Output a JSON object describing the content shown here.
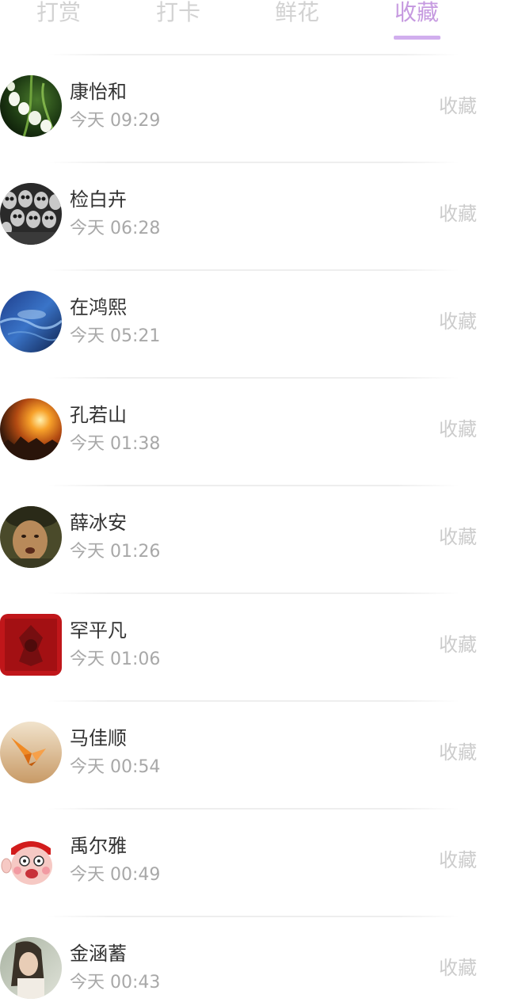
{
  "tabs": [
    {
      "label": "打赏",
      "active": false
    },
    {
      "label": "打卡",
      "active": false
    },
    {
      "label": "鲜花",
      "active": false
    },
    {
      "label": "收藏",
      "active": true
    }
  ],
  "accent_color": "#c69ae0",
  "items": [
    {
      "name": "康怡和",
      "time": "今天 09:29",
      "action": "收藏",
      "avatar": "lily-of-the-valley-flowers"
    },
    {
      "name": "检白卉",
      "time": "今天 06:28",
      "action": "收藏",
      "avatar": "skull-crowd"
    },
    {
      "name": "在鸿熙",
      "time": "今天 05:21",
      "action": "收藏",
      "avatar": "blue-ocean"
    },
    {
      "name": "孔若山",
      "time": "今天 01:38",
      "action": "收藏",
      "avatar": "fiery-explosion"
    },
    {
      "name": "薛冰安",
      "time": "今天 01:26",
      "action": "收藏",
      "avatar": "man-face"
    },
    {
      "name": "罕平凡",
      "time": "今天 01:06",
      "action": "收藏",
      "avatar": "red-pattern"
    },
    {
      "name": "马佳顺",
      "time": "今天 00:54",
      "action": "收藏",
      "avatar": "paper-crane-on-sand"
    },
    {
      "name": "禹尔雅",
      "time": "今天 00:49",
      "action": "收藏",
      "avatar": "cartoon-emoji-face"
    },
    {
      "name": "金涵蓄",
      "time": "今天 00:43",
      "action": "收藏",
      "avatar": "girl-portrait"
    }
  ]
}
